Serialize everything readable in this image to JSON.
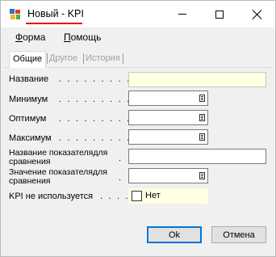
{
  "window": {
    "title": "Новый - KPI",
    "accent_underline_color": "#e8000b",
    "controls": {
      "minimize_icon": "minimize-icon",
      "maximize_icon": "maximize-icon",
      "close_icon": "close-icon"
    }
  },
  "menu": {
    "forma_first": "Ф",
    "forma_rest": "орма",
    "help_first": "П",
    "help_rest": "омощь"
  },
  "tabs": [
    {
      "label": "Общие",
      "active": true
    },
    {
      "label": "Другое",
      "active": false
    },
    {
      "label": "История",
      "active": false
    }
  ],
  "form": {
    "name_label": "Название",
    "minimum_label": "Минимум",
    "optimum_label": "Оптимум",
    "maximum_label": "Максимум",
    "compare_name_label_line1": "Название показателядля",
    "compare_name_label_line2": "сравнения",
    "compare_value_label_line1": "Значение показателядля",
    "compare_value_label_line2": "сравнения",
    "kpi_unused_label": "KPI не используется",
    "kpi_unused_value": "Нет",
    "name_value": "",
    "minimum_value": "",
    "optimum_value": "",
    "maximum_value": "",
    "compare_name_value": "",
    "compare_value_value": ""
  },
  "buttons": {
    "ok": "Ok",
    "cancel": "Отмена"
  },
  "colors": {
    "required_field_bg": "#ffffe1",
    "default_button_border": "#0078d7"
  }
}
